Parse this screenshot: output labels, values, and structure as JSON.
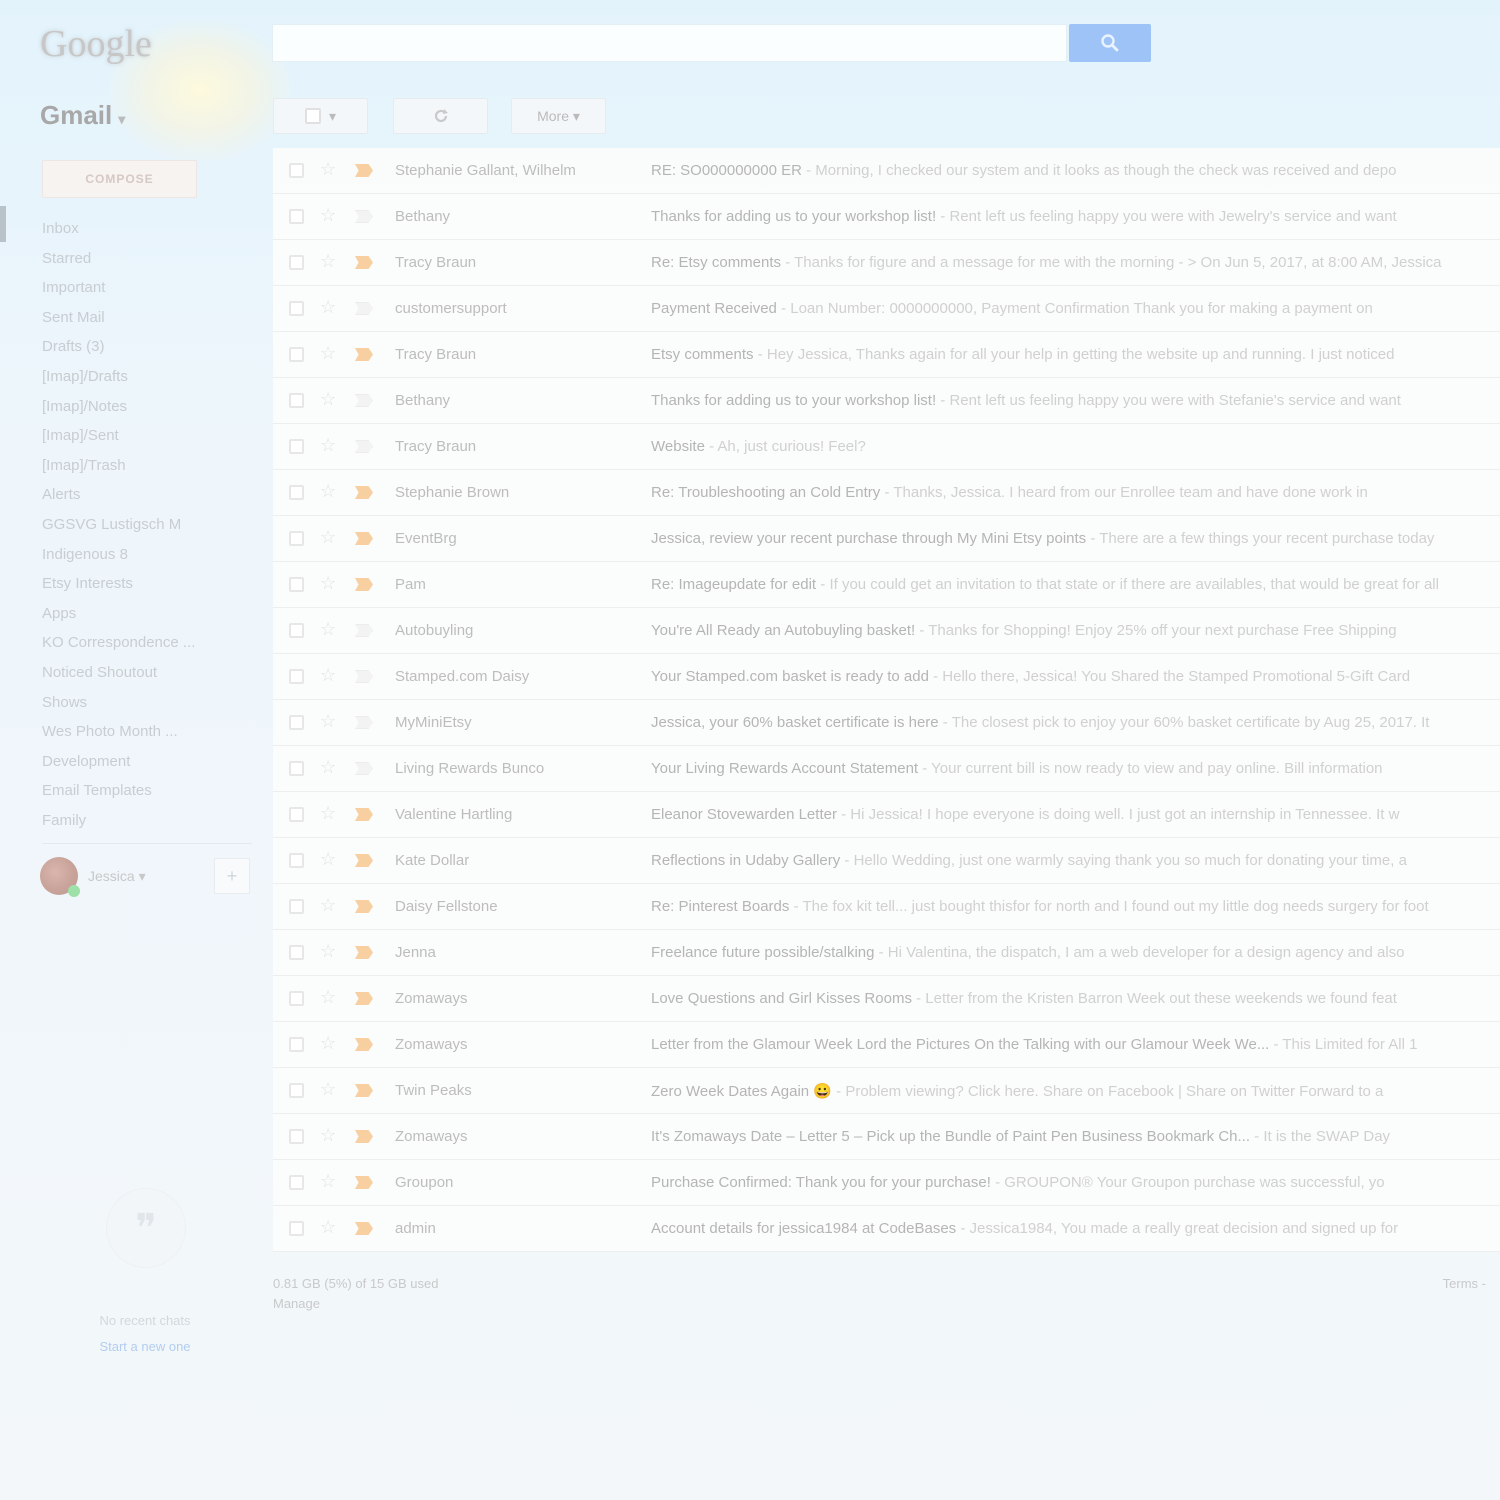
{
  "header": {
    "logo": "Google",
    "search_placeholder": "",
    "search_button_icon": "search-icon"
  },
  "app": {
    "name": "Gmail",
    "caret": "▾"
  },
  "toolbar": {
    "select_caret": "▾",
    "refresh_icon": "refresh-icon",
    "more_label": "More ▾"
  },
  "sidebar": {
    "compose_label": "COMPOSE",
    "items": [
      {
        "label": "Inbox"
      },
      {
        "label": "Starred"
      },
      {
        "label": "Important"
      },
      {
        "label": "Sent Mail"
      },
      {
        "label": "Drafts (3)"
      },
      {
        "label": "[Imap]/Drafts"
      },
      {
        "label": "[Imap]/Notes"
      },
      {
        "label": "[Imap]/Sent"
      },
      {
        "label": "[Imap]/Trash"
      },
      {
        "label": "Alerts"
      },
      {
        "label": "GGSVG Lustigsch M"
      },
      {
        "label": "Indigenous 8"
      },
      {
        "label": "Etsy Interests"
      },
      {
        "label": "Apps"
      },
      {
        "label": "KO Correspondence ..."
      },
      {
        "label": "Noticed Shoutout"
      },
      {
        "label": "Shows"
      },
      {
        "label": "Wes Photo Month ..."
      },
      {
        "label": "Development"
      },
      {
        "label": "Email Templates"
      },
      {
        "label": "Family"
      }
    ],
    "account_name": "Jessica",
    "account_caret": "▾",
    "add_label": "+"
  },
  "hangouts": {
    "bubble_glyph": "❞",
    "no_chats": "No recent chats",
    "start_new": "Start a new one"
  },
  "messages": [
    {
      "sender": "Stephanie Gallant, Wilhelm",
      "important": true,
      "subject": "RE: SO000000000 ER",
      "snippet": " - Morning, I checked our system and it looks as though the check was received and depo"
    },
    {
      "sender": "Bethany",
      "important": false,
      "subject": "Thanks for adding us to your workshop list!",
      "snippet": " - Rent left us feeling happy you were with Jewelry's service and want"
    },
    {
      "sender": "Tracy Braun",
      "important": true,
      "subject": "Re: Etsy comments",
      "snippet": " - Thanks for figure and a message for me with the morning - > On Jun 5, 2017, at 8:00 AM, Jessica"
    },
    {
      "sender": "customersupport",
      "important": false,
      "subject": "Payment Received",
      "snippet": " - Loan Number: 0000000000, Payment Confirmation Thank you for making a payment on"
    },
    {
      "sender": "Tracy Braun",
      "important": true,
      "subject": "Etsy comments",
      "snippet": " - Hey Jessica, Thanks again for all your help in getting the website up and running. I just noticed"
    },
    {
      "sender": "Bethany",
      "important": false,
      "subject": "Thanks for adding us to your workshop list!",
      "snippet": " - Rent left us feeling happy you were with Stefanie's service and want"
    },
    {
      "sender": "Tracy Braun",
      "important": false,
      "subject": "Website",
      "snippet": " - Ah, just curious! Feel?"
    },
    {
      "sender": "Stephanie Brown",
      "important": true,
      "subject": "Re: Troubleshooting an Cold Entry",
      "snippet": " - Thanks, Jessica. I heard from our Enrollee team and have done work in"
    },
    {
      "sender": "EventBrg",
      "important": true,
      "subject": "Jessica, review your recent purchase through My Mini Etsy points",
      "snippet": " - There are a few things your recent purchase today"
    },
    {
      "sender": "Pam",
      "important": true,
      "subject": "Re: Imageupdate for edit",
      "snippet": " - If you could get an invitation to that state or if there are availables, that would be great for all"
    },
    {
      "sender": "Autobuyling",
      "important": false,
      "subject": "You're All Ready an Autobuyling basket!",
      "snippet": " - Thanks for Shopping! Enjoy 25% off your next purchase Free Shipping"
    },
    {
      "sender": "Stamped.com Daisy",
      "important": false,
      "subject": "Your Stamped.com basket is ready to add",
      "snippet": " - Hello there, Jessica! You Shared the Stamped Promotional 5-Gift Card"
    },
    {
      "sender": "MyMiniEtsy",
      "important": false,
      "subject": "Jessica, your 60% basket certificate is here",
      "snippet": " - The closest pick to enjoy your 60% basket certificate by Aug 25, 2017. It"
    },
    {
      "sender": "Living Rewards Bunco",
      "important": false,
      "subject": "Your Living Rewards Account Statement",
      "snippet": " - Your current bill is now ready to view and pay online. Bill information"
    },
    {
      "sender": "Valentine Hartling",
      "important": true,
      "subject": "Eleanor Stovewarden Letter",
      "snippet": " - Hi Jessica! I hope everyone is doing well. I just got an internship in Tennessee. It w"
    },
    {
      "sender": "Kate Dollar",
      "important": true,
      "subject": "Reflections in Udaby Gallery",
      "snippet": " - Hello Wedding, just one warmly saying thank you so much for donating your time, a"
    },
    {
      "sender": "Daisy Fellstone",
      "important": true,
      "subject": "Re: Pinterest Boards",
      "snippet": " - The fox kit tell... just bought thisfor for north and I found out my little dog needs surgery for foot"
    },
    {
      "sender": "Jenna",
      "important": true,
      "subject": "Freelance future possible/stalking",
      "snippet": " - Hi Valentina, the dispatch, I am a web developer for a design agency and also"
    },
    {
      "sender": "Zomaways",
      "important": true,
      "subject": "Love Questions and Girl Kisses Rooms",
      "snippet": " - Letter from the Kristen Barron Week out these weekends we found feat"
    },
    {
      "sender": "Zomaways",
      "important": true,
      "subject": "Letter from the Glamour Week Lord the Pictures On the Talking with our Glamour Week We...",
      "snippet": " - This Limited for All 1"
    },
    {
      "sender": "Twin Peaks",
      "important": true,
      "subject": "Zero Week Dates Again 😀",
      "snippet": " - Problem viewing? Click here. Share on Facebook | Share on Twitter Forward to a"
    },
    {
      "sender": "Zomaways",
      "important": true,
      "subject": "It's Zomaways Date – Letter 5 – Pick up the Bundle of Paint Pen Business Bookmark Ch...",
      "snippet": " - It is the SWAP Day"
    },
    {
      "sender": "Groupon",
      "important": true,
      "subject": "Purchase Confirmed: Thank you for your purchase!",
      "snippet": " - GROUPON® Your Groupon purchase was successful, yo"
    },
    {
      "sender": "admin",
      "important": true,
      "subject": "Account details for jessica1984 at CodeBases",
      "snippet": " - Jessica1984, You made a really great decision and signed up for"
    }
  ],
  "footer": {
    "storage_line1": "0.81 GB (5%) of 15 GB used",
    "storage_line2": "Manage",
    "terms": "Terms -"
  }
}
